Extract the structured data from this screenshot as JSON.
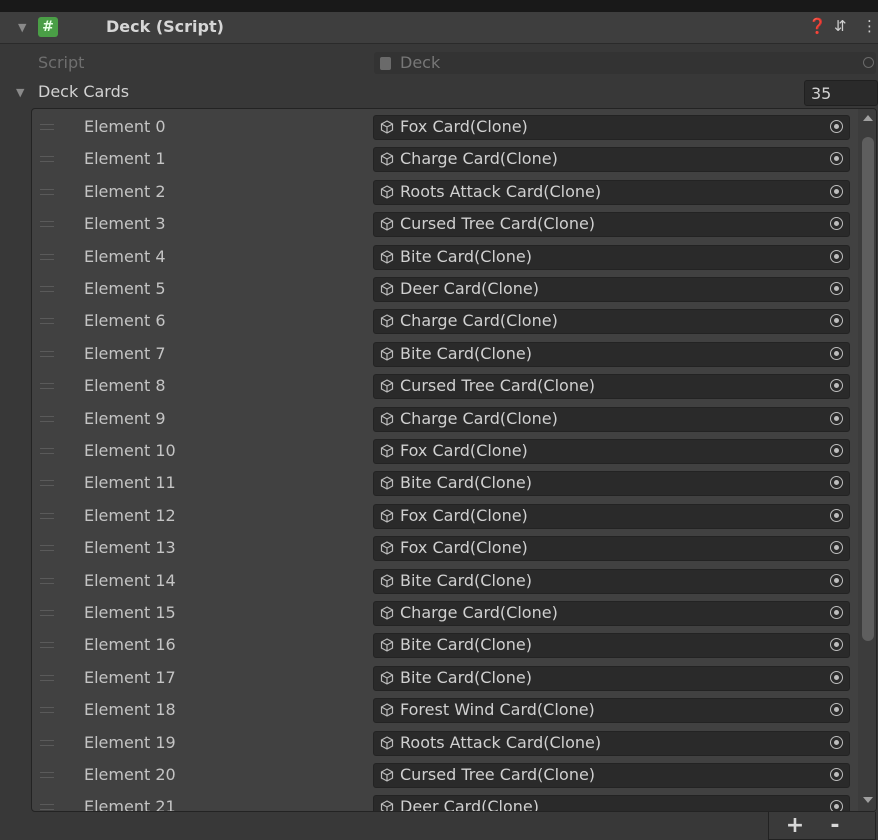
{
  "component": {
    "title": "Deck (Script)"
  },
  "script": {
    "label": "Script",
    "value": "Deck"
  },
  "deck_cards": {
    "label": "Deck Cards",
    "count": "35",
    "items": [
      {
        "label": "Element 0",
        "value": "Fox Card(Clone)"
      },
      {
        "label": "Element 1",
        "value": "Charge Card(Clone)"
      },
      {
        "label": "Element 2",
        "value": "Roots Attack Card(Clone)"
      },
      {
        "label": "Element 3",
        "value": "Cursed Tree Card(Clone)"
      },
      {
        "label": "Element 4",
        "value": "Bite Card(Clone)"
      },
      {
        "label": "Element 5",
        "value": "Deer Card(Clone)"
      },
      {
        "label": "Element 6",
        "value": "Charge Card(Clone)"
      },
      {
        "label": "Element 7",
        "value": "Bite Card(Clone)"
      },
      {
        "label": "Element 8",
        "value": "Cursed Tree Card(Clone)"
      },
      {
        "label": "Element 9",
        "value": "Charge Card(Clone)"
      },
      {
        "label": "Element 10",
        "value": "Fox Card(Clone)"
      },
      {
        "label": "Element 11",
        "value": "Bite Card(Clone)"
      },
      {
        "label": "Element 12",
        "value": "Fox Card(Clone)"
      },
      {
        "label": "Element 13",
        "value": "Fox Card(Clone)"
      },
      {
        "label": "Element 14",
        "value": "Bite Card(Clone)"
      },
      {
        "label": "Element 15",
        "value": "Charge Card(Clone)"
      },
      {
        "label": "Element 16",
        "value": "Bite Card(Clone)"
      },
      {
        "label": "Element 17",
        "value": "Bite Card(Clone)"
      },
      {
        "label": "Element 18",
        "value": "Forest Wind Card(Clone)"
      },
      {
        "label": "Element 19",
        "value": "Roots Attack Card(Clone)"
      },
      {
        "label": "Element 20",
        "value": "Cursed Tree Card(Clone)"
      },
      {
        "label": "Element 21",
        "value": "Deer Card(Clone)"
      }
    ]
  },
  "footer": {
    "add_label": "+",
    "remove_label": "-"
  },
  "icons": {
    "help": "help-icon",
    "settings": "preset-settings-icon",
    "more": "more-options-icon",
    "script": "script-file-icon",
    "prefab": "prefab-cube-icon",
    "picker": "object-picker-icon"
  }
}
